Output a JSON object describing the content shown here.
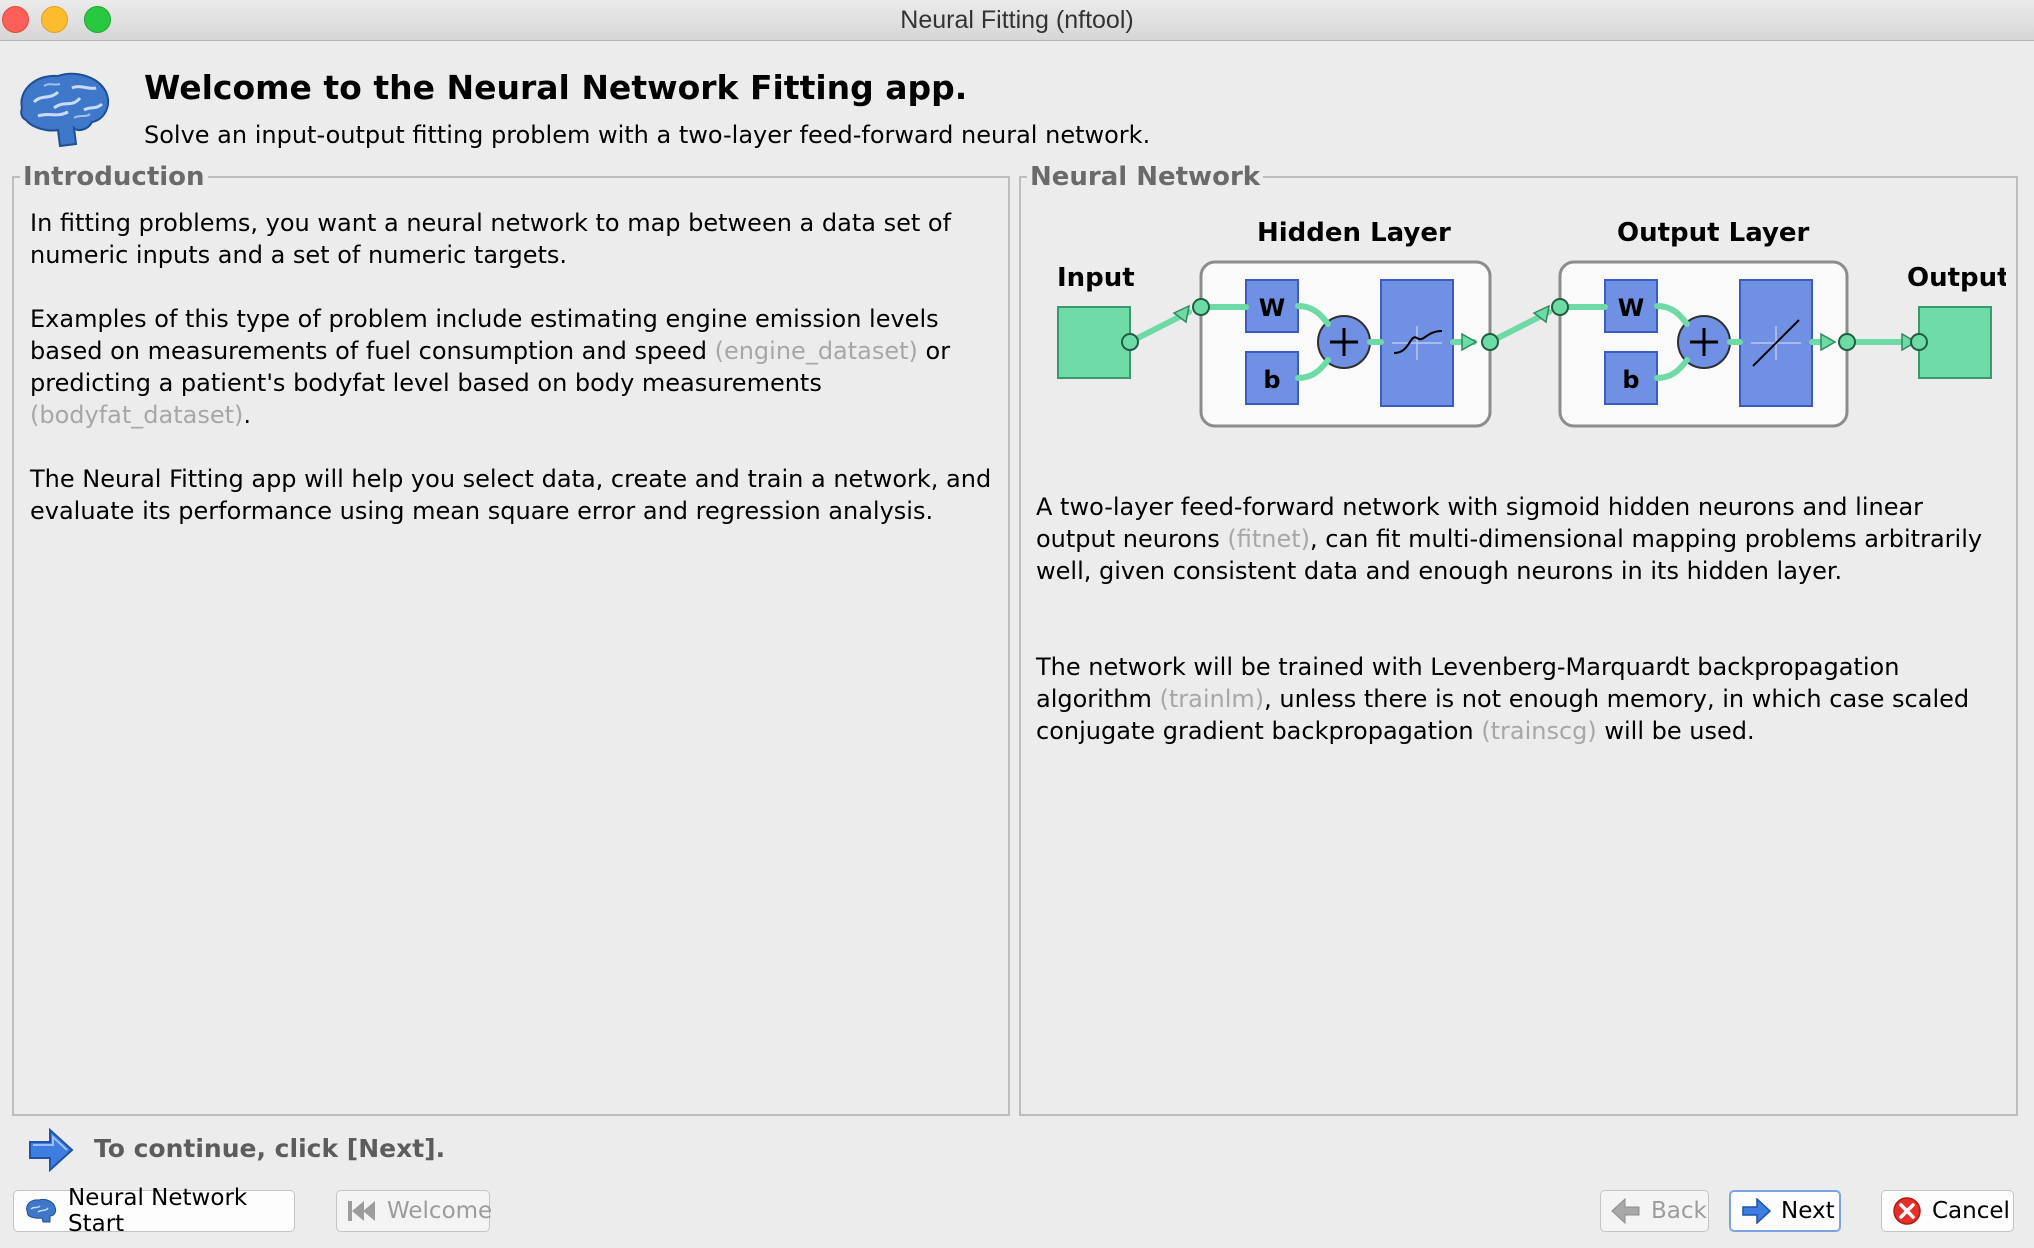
{
  "window": {
    "title": "Neural Fitting (nftool)"
  },
  "header": {
    "title": "Welcome to the Neural Network Fitting app.",
    "subtitle": "Solve an input-output fitting problem with a two-layer feed-forward neural network."
  },
  "intro": {
    "legend": "Introduction",
    "p1": "In fitting problems, you want a neural network to map between a data set of numeric inputs and a set of numeric targets.",
    "p2_before": "Examples of this type of problem include estimating engine emission levels based on measurements of fuel consumption and speed ",
    "p2_hint1": "(engine_dataset)",
    "p2_middle": " or predicting a patient's bodyfat level based on body measurements ",
    "p2_hint2": "(bodyfat_dataset)",
    "p2_after": ".",
    "p3": "The Neural Fitting app will help you select data, create and train a network, and evaluate its performance using mean square error and regression analysis."
  },
  "network": {
    "legend": "Neural Network",
    "diagram": {
      "input_label": "Input",
      "hidden_label": "Hidden Layer",
      "output_layer_label": "Output Layer",
      "output_label": "Output",
      "weight_label": "W",
      "bias_label": "b"
    },
    "p1_before": "A two-layer feed-forward network with sigmoid hidden neurons and linear output neurons ",
    "p1_hint": "(fitnet)",
    "p1_after": ", can fit multi-dimensional mapping problems arbitrarily well, given consistent data and enough neurons in its hidden layer.",
    "p2_before": "The network will be trained with Levenberg-Marquardt backpropagation algorithm ",
    "p2_hint1": "(trainlm)",
    "p2_middle": ", unless there is not enough memory, in which case scaled conjugate gradient backpropagation ",
    "p2_hint2": "(trainscg)",
    "p2_after": " will be used."
  },
  "footer": {
    "continue_text": "To continue, click [Next].",
    "buttons": {
      "start": "Neural Network Start",
      "welcome": "Welcome",
      "back": "Back",
      "next": "Next",
      "cancel": "Cancel"
    }
  },
  "colors": {
    "accent": "#3f7ee0",
    "block_blue": "#6f90e3",
    "node_green": "#6edba6",
    "hint_gray": "#a7a7a7",
    "cancel_red": "#e4302b"
  }
}
